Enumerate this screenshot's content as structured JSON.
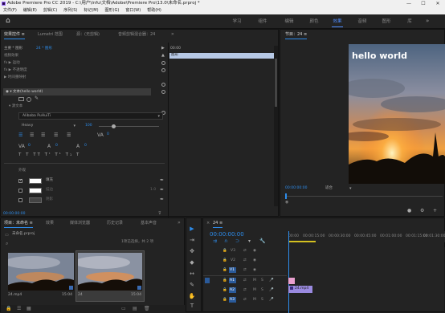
{
  "window": {
    "title": "Adobe Premiere Pro CC 2019 - C:\\用户\\lnfu\\文档\\Adobe\\Premiere Pro\\13.0\\未命名.prproj *",
    "controls": [
      "—",
      "☐",
      "✕"
    ]
  },
  "menu": [
    "文件(F)",
    "编辑(E)",
    "剪辑(C)",
    "序列(S)",
    "标记(M)",
    "图形(G)",
    "窗口(W)",
    "帮助(H)"
  ],
  "workspaces": [
    "学习",
    "组件",
    "编辑",
    "颜色",
    "效果",
    "音频",
    "图形",
    "库"
  ],
  "home_icon": "⌂",
  "effect_controls": {
    "tabs": [
      "效果控件 ≡",
      "Lumetri 范围",
      "源：(无剪辑)",
      "音频剪辑混合器：24"
    ],
    "master_label": "主要 * 图形",
    "clip_label": "24 * 图形",
    "section_label": "视频效果",
    "timecode_top": "00:00",
    "clip_bar_label": "图形",
    "rows": [
      "fx ▶ 运动",
      "fx ▶ 不透明度",
      "▶ 时间重映射",
      "◉ ▾ 文本(hello world)",
      "▾ 源文本"
    ],
    "motion_label": "fx > 运动",
    "font": "Alibaba PuHuiTi",
    "weight": "Heavy",
    "size": "100",
    "tracking": "0",
    "leading": "0",
    "kerning": "0",
    "baseline": "0",
    "appearance_title": "外观",
    "fill_label": "填充",
    "stroke_label": "描边",
    "shadow_label": "阴影",
    "stroke_value": "1.0",
    "bottom_timecode": "00:00:00:00"
  },
  "program": {
    "title": "节目：24 ≡",
    "overlay_text": "hello world",
    "timecode": "00:00:00:00",
    "fit": "适合",
    "quality": "完整",
    "duration": "00:00:15:00"
  },
  "project": {
    "tabs": [
      "项目：未命名 ≡",
      "效果",
      "媒体浏览器",
      "历史记录",
      "基本声音"
    ],
    "path": "未命名.prproj",
    "selection": "1项已选择，共 2 项",
    "items": [
      {
        "name": "24.mp4",
        "duration": "15:04"
      },
      {
        "name": "24",
        "duration": "15:04"
      }
    ]
  },
  "tools": [
    "▶",
    "⇥",
    "✥",
    "◆",
    "↔",
    "✎",
    "✋",
    "T"
  ],
  "timeline": {
    "tab": "24 ≡",
    "timecode": "00:00:00:00",
    "ruler": [
      "00:00",
      "00:00:15:00",
      "00:00:30:00",
      "00:00:45:00",
      "00:01:00:00",
      "00:01:15:00",
      "00:01:30:00",
      "00:01:45:00"
    ],
    "video_tracks": [
      "V3",
      "V2",
      "V1"
    ],
    "audio_tracks": [
      "A1",
      "A2",
      "A3"
    ],
    "clip_label": "24.mp4",
    "track_btns": [
      "M",
      "S"
    ]
  },
  "colors": {
    "accent": "#2d8ceb",
    "timecode": "#2d8ceb",
    "graphic_clip": "#e9a0cf",
    "video_clip": "#9a8ae0",
    "active_workspace": "#4f8cff"
  }
}
